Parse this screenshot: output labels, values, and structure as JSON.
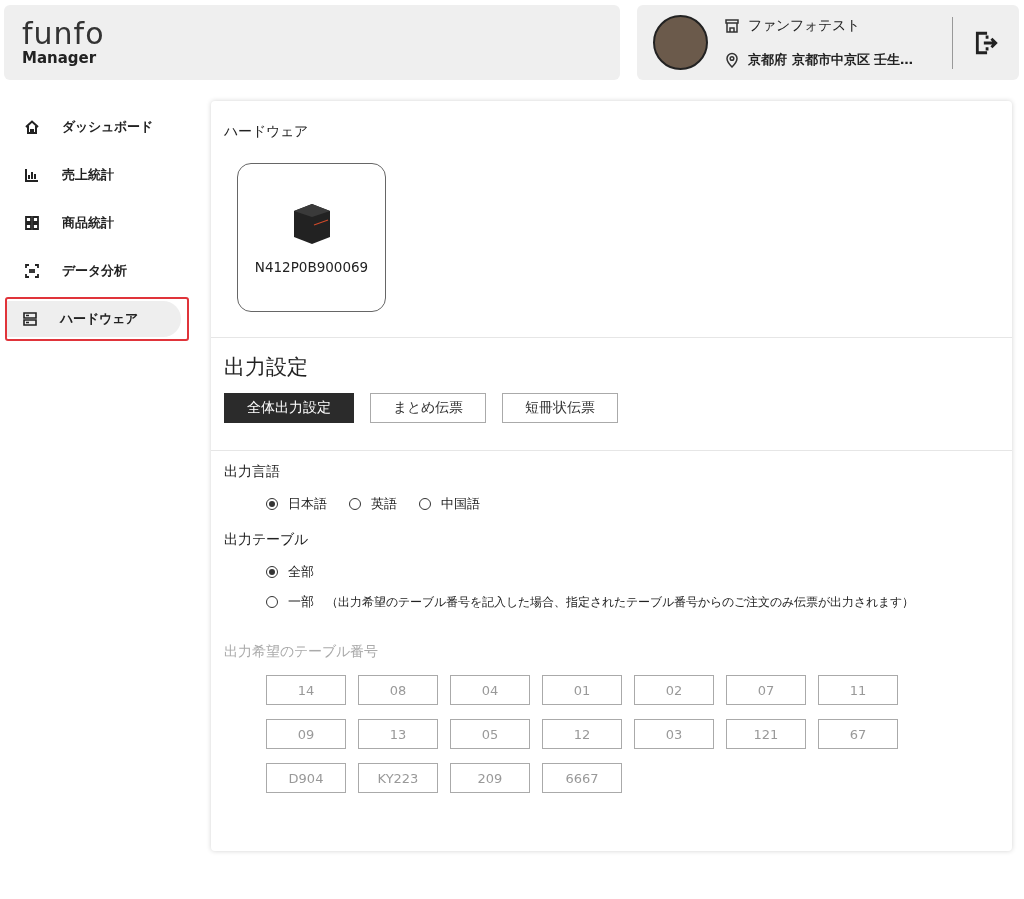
{
  "brand": {
    "logo": "funfo",
    "subtitle": "Manager"
  },
  "store": {
    "name": "ファンフォテスト",
    "address": "京都府 京都市中京区 壬生…"
  },
  "sidebar": {
    "items": [
      {
        "label": "ダッシュボード",
        "selected": false
      },
      {
        "label": "売上統計",
        "selected": false
      },
      {
        "label": "商品統計",
        "selected": false
      },
      {
        "label": "データ分析",
        "selected": false
      },
      {
        "label": "ハードウェア",
        "selected": true
      }
    ]
  },
  "hardware": {
    "title": "ハードウェア",
    "devices": [
      {
        "name": "N412P0B900069"
      }
    ]
  },
  "output": {
    "title": "出力設定",
    "tabs": [
      {
        "label": "全体出力設定",
        "selected": true
      },
      {
        "label": "まとめ伝票",
        "selected": false
      },
      {
        "label": "短冊状伝票",
        "selected": false
      }
    ],
    "language": {
      "label": "出力言語",
      "options": [
        {
          "label": "日本語",
          "selected": true
        },
        {
          "label": "英語",
          "selected": false
        },
        {
          "label": "中国語",
          "selected": false
        }
      ]
    },
    "table": {
      "label": "出力テーブル",
      "options": [
        {
          "label": "全部",
          "selected": true
        },
        {
          "label": "一部",
          "selected": false,
          "note": "（出力希望のテーブル番号を記入した場合、指定されたテーブル番号からのご注文のみ伝票が出力されます）"
        }
      ]
    },
    "numbers": {
      "label": "出力希望のテーブル番号",
      "disabled": true,
      "values": [
        "14",
        "08",
        "04",
        "01",
        "02",
        "07",
        "11",
        "09",
        "13",
        "05",
        "12",
        "03",
        "121",
        "67",
        "D904",
        "KY223",
        "209",
        "6667"
      ]
    }
  }
}
